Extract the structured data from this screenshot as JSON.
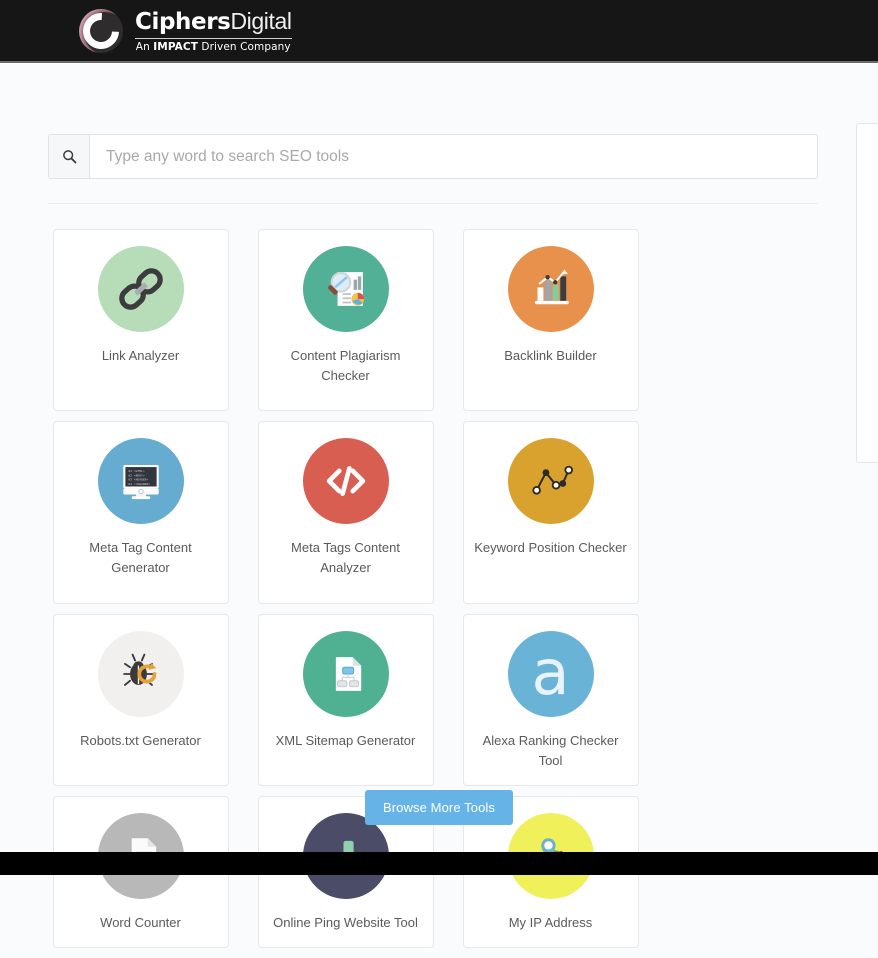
{
  "header": {
    "logo_icon": "ciphers-circle-c-logo",
    "brand_bold": "Ciphers",
    "brand_light": "Digital",
    "tagline_prefix": "An ",
    "tagline_strong": "IMPACT",
    "tagline_suffix": " Driven Company",
    "tagline_full": "An IMPACT Driven Company"
  },
  "search": {
    "icon": "search-icon",
    "placeholder": "Type any word to search SEO tools",
    "value": ""
  },
  "tools": [
    {
      "label": "Link Analyzer",
      "icon": "chain-link-icon",
      "circle": "#b6ddb7"
    },
    {
      "label": "Content Plagiarism\nChecker",
      "icon": "magnifier-report-icon",
      "circle": "#52b096"
    },
    {
      "label": "Backlink Builder",
      "icon": "bar-chart-growth-icon",
      "circle": "#e8914d"
    },
    {
      "label": "Meta Tag Content\nGenerator",
      "icon": "monitor-code-icon",
      "circle": "#66abd0"
    },
    {
      "label": "Meta Tags Content\nAnalyzer",
      "icon": "code-brackets-icon",
      "circle": "#d95e52"
    },
    {
      "label": "Keyword Position Checker",
      "icon": "line-graph-nodes-icon",
      "circle": "#d9a22e"
    },
    {
      "label": "Robots.txt Generator",
      "icon": "bug-refresh-icon",
      "circle": "#f2f0ee"
    },
    {
      "label": "XML Sitemap Generator",
      "icon": "sitemap-document-icon",
      "circle": "#4fb192"
    },
    {
      "label": "Alexa Ranking Checker Tool",
      "icon": "alexa-a-icon",
      "circle": "#68b3d6"
    },
    {
      "label": "Word Counter",
      "icon": "document-lines-icon",
      "circle": "#b8b8b8"
    },
    {
      "label": "Online Ping Website Tool",
      "icon": "bar-chart-dark-icon",
      "circle": "#4b4c68"
    },
    {
      "label": "My IP Address",
      "icon": "map-pin-location-icon",
      "circle": "#f0f05a"
    }
  ],
  "footer": {
    "browse_more_label": "Browse More Tools"
  },
  "colors": {
    "topbar": "#161616",
    "bottombar": "#000000",
    "page_bg": "#fafbfc",
    "accent_button": "#66b3e8",
    "card_border": "#e6e8ea",
    "label_text": "#5a5a5a"
  }
}
